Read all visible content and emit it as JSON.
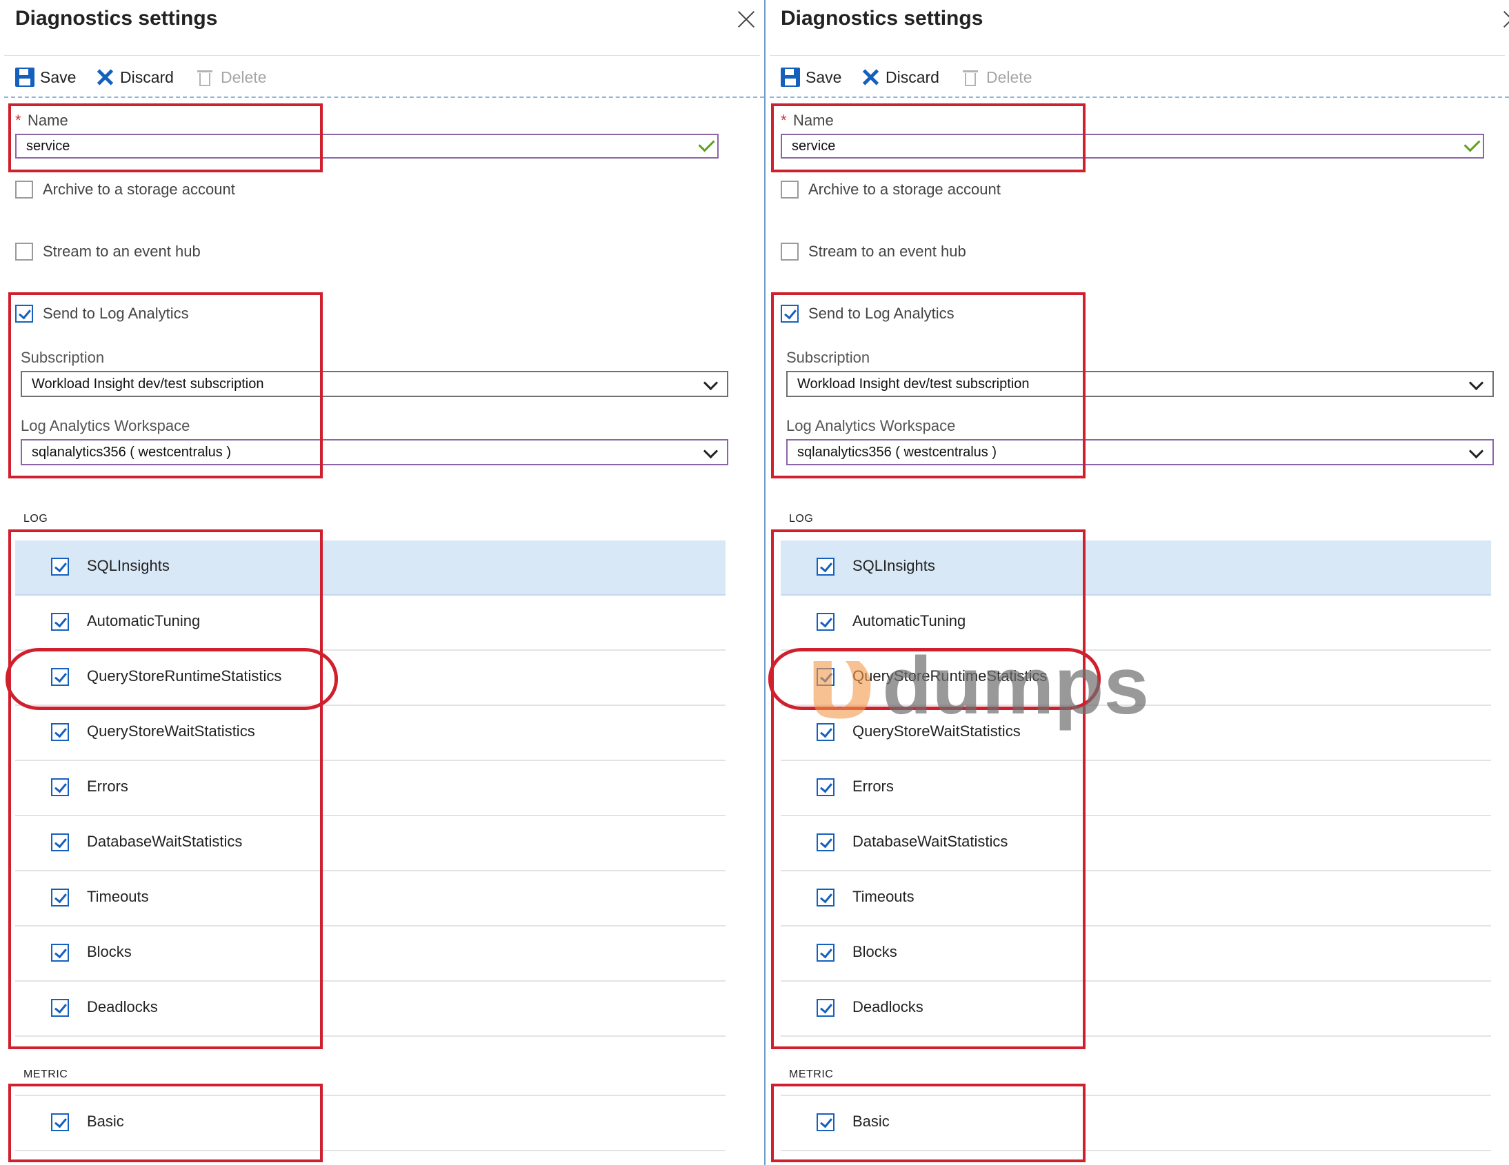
{
  "panels": [
    {
      "title": "Diagnostics settings",
      "toolbar": {
        "save": "Save",
        "discard": "Discard",
        "delete": "Delete"
      },
      "name_label": "Name",
      "required_marker": "*",
      "name_value": "service",
      "archive_label": "Archive to a storage account",
      "archive_checked": false,
      "stream_label": "Stream to an event hub",
      "stream_checked": false,
      "log_analytics_label": "Send to Log Analytics",
      "log_analytics_checked": true,
      "subscription_label": "Subscription",
      "subscription_value": "Workload Insight dev/test subscription",
      "workspace_label": "Log Analytics Workspace",
      "workspace_value": "sqlanalytics356 ( westcentralus )",
      "log_header": "LOG",
      "logs": [
        {
          "label": "SQLInsights",
          "checked": true
        },
        {
          "label": "AutomaticTuning",
          "checked": true
        },
        {
          "label": "QueryStoreRuntimeStatistics",
          "checked": true
        },
        {
          "label": "QueryStoreWaitStatistics",
          "checked": true
        },
        {
          "label": "Errors",
          "checked": true
        },
        {
          "label": "DatabaseWaitStatistics",
          "checked": true
        },
        {
          "label": "Timeouts",
          "checked": true
        },
        {
          "label": "Blocks",
          "checked": true
        },
        {
          "label": "Deadlocks",
          "checked": true
        }
      ],
      "metric_header": "METRIC",
      "metrics": [
        {
          "label": "Basic",
          "checked": true
        }
      ]
    },
    {
      "title": "Diagnostics settings",
      "toolbar": {
        "save": "Save",
        "discard": "Discard",
        "delete": "Delete"
      },
      "name_label": "Name",
      "required_marker": "*",
      "name_value": "service",
      "archive_label": "Archive to a storage account",
      "archive_checked": false,
      "stream_label": "Stream to an event hub",
      "stream_checked": false,
      "log_analytics_label": "Send to Log Analytics",
      "log_analytics_checked": true,
      "subscription_label": "Subscription",
      "subscription_value": "Workload Insight dev/test subscription",
      "workspace_label": "Log Analytics Workspace",
      "workspace_value": "sqlanalytics356 ( westcentralus )",
      "log_header": "LOG",
      "logs": [
        {
          "label": "SQLInsights",
          "checked": true
        },
        {
          "label": "AutomaticTuning",
          "checked": true
        },
        {
          "label": "QueryStoreRuntimeStatistics",
          "checked": true
        },
        {
          "label": "QueryStoreWaitStatistics",
          "checked": true
        },
        {
          "label": "Errors",
          "checked": true
        },
        {
          "label": "DatabaseWaitStatistics",
          "checked": true
        },
        {
          "label": "Timeouts",
          "checked": true
        },
        {
          "label": "Blocks",
          "checked": true
        },
        {
          "label": "Deadlocks",
          "checked": true
        }
      ],
      "metric_header": "METRIC",
      "metrics": [
        {
          "label": "Basic",
          "checked": true
        }
      ]
    }
  ],
  "watermark": {
    "logo": "υ",
    "text": "dumps"
  },
  "colors": {
    "accent": "#1560bd",
    "highlight": "#d0202e",
    "selected_row": "#d9e8f6",
    "valid": "#5ea317"
  }
}
